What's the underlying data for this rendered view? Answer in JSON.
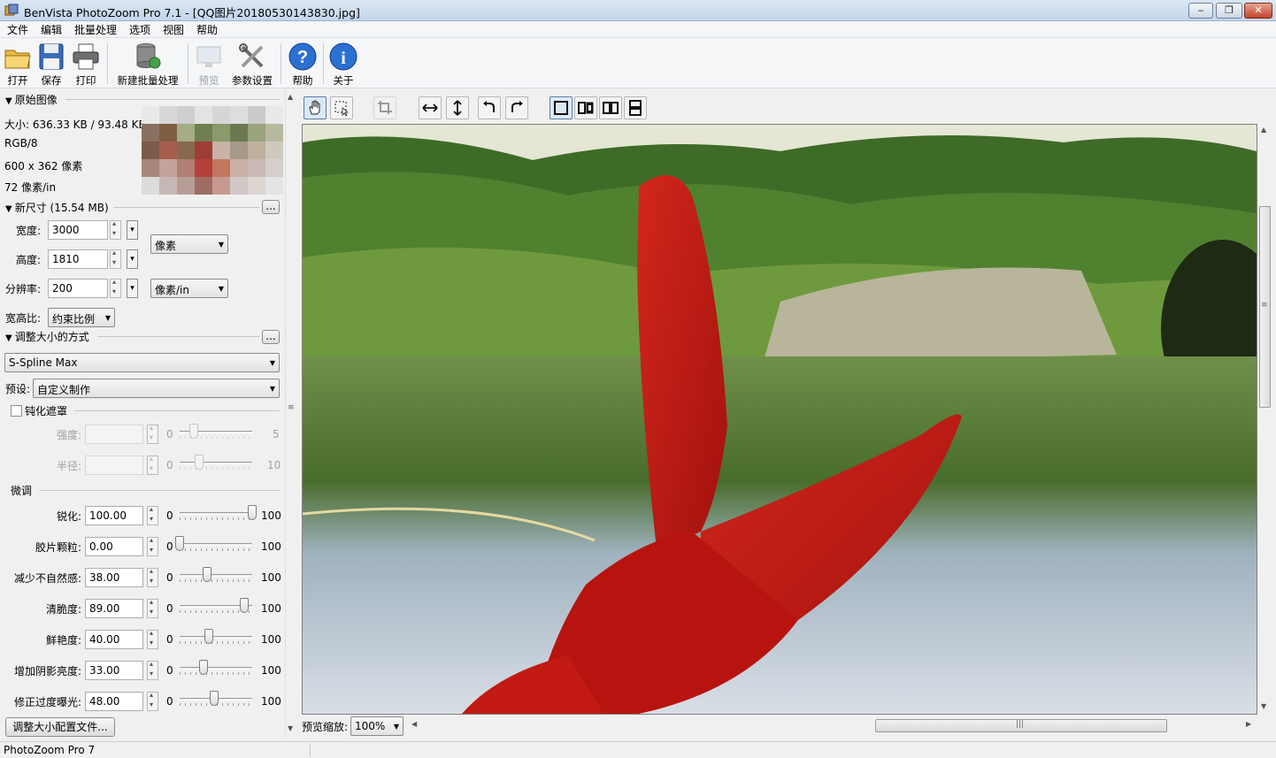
{
  "window": {
    "title": "BenVista PhotoZoom Pro 7.1 - [QQ图片20180530143830.jpg]",
    "min_glyph": "‒",
    "max_glyph": "❐",
    "close_glyph": "✕"
  },
  "menu": [
    "文件",
    "编辑",
    "批量处理",
    "选项",
    "视图",
    "帮助"
  ],
  "toolbar": {
    "open": "打开",
    "save": "保存",
    "print": "打印",
    "batch": "新建批量处理",
    "preview": "预览",
    "settings": "参数设置",
    "help": "帮助",
    "about": "关于"
  },
  "original": {
    "header": "原始图像",
    "size": "大小: 636.33 KB / 93.48 KB",
    "color": "RGB/8",
    "pixels": "600 x 362 像素",
    "resolution": "72 像素/in"
  },
  "new_size": {
    "header": "新尺寸 (15.54 MB)",
    "more": "...",
    "width_label": "宽度:",
    "width": "3000",
    "height_label": "高度:",
    "height": "1810",
    "res_label": "分辨率:",
    "res": "200",
    "unit": "像素",
    "res_unit": "像素/in",
    "aspect_label": "宽高比:",
    "aspect": "约束比例"
  },
  "resize_method": {
    "header": "调整大小的方式",
    "more": "...",
    "method": "S-Spline Max",
    "preset_label": "预设:",
    "preset": "自定义制作"
  },
  "unsharp": {
    "header": "钝化遮罩",
    "checked": false,
    "rows": [
      {
        "label": "强度:",
        "min": "0",
        "max": "5",
        "level": 0.2
      },
      {
        "label": "半径:",
        "min": "0",
        "max": "10",
        "level": 0.27
      }
    ]
  },
  "finetune": {
    "header": "微调",
    "rows": [
      {
        "label": "锐化:",
        "value": "100.00",
        "min": "0",
        "max": "100",
        "level": 1.0
      },
      {
        "label": "胶片颗粒:",
        "value": "0.00",
        "min": "0",
        "max": "100",
        "level": 0.0
      },
      {
        "label": "减少不自然感:",
        "value": "38.00",
        "min": "0",
        "max": "100",
        "level": 0.38
      },
      {
        "label": "清脆度:",
        "value": "89.00",
        "min": "0",
        "max": "100",
        "level": 0.89
      },
      {
        "label": "鲜艳度:",
        "value": "40.00",
        "min": "0",
        "max": "100",
        "level": 0.4
      },
      {
        "label": "增加阴影亮度:",
        "value": "33.00",
        "min": "0",
        "max": "100",
        "level": 0.33
      },
      {
        "label": "修正过度曝光:",
        "value": "48.00",
        "min": "0",
        "max": "100",
        "level": 0.48
      }
    ]
  },
  "profile_button": "调整大小配置文件...",
  "preview": {
    "zoom_label": "预览缩放:",
    "zoom": "100%",
    "grip": "≡",
    "hgrip": "|||"
  },
  "status": "PhotoZoom Pro 7"
}
